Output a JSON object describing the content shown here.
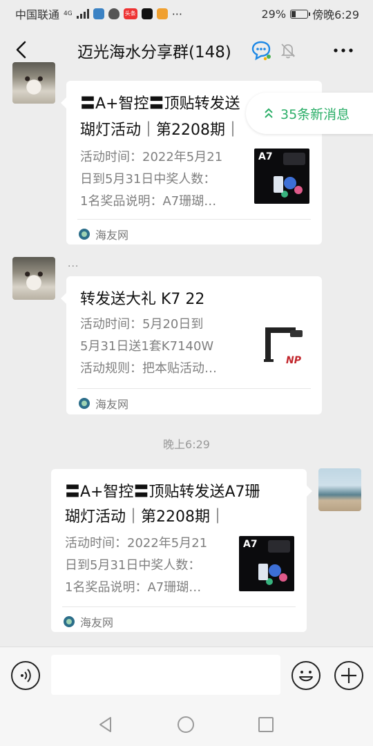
{
  "status_bar": {
    "carrier": "中国联通",
    "network": "4G",
    "app_badge": "头条",
    "more": "···",
    "battery": "29%",
    "battery_level": 0.29,
    "time": "傍晚6:29"
  },
  "header": {
    "title": "迈光海水分享群(148)"
  },
  "new_messages": {
    "label": "35条新消息"
  },
  "messages": [
    {
      "sender": "left",
      "title_lines": [
        "〓A+智控〓顶贴转发送",
        "瑚灯活动｜第2208期｜"
      ],
      "desc_lines": [
        "活动时间：2022年5月21",
        "日到5月31日中奖人数：",
        "1名奖品说明：A7珊瑚…"
      ],
      "thumb_label": "A7",
      "source": "海友网"
    },
    {
      "sender": "left",
      "sender_name": "...",
      "title_lines": [
        "转发送大礼 K7 22"
      ],
      "desc_lines": [
        "活动时间：5月20日到",
        "5月31日送1套K7140W",
        "活动规则：把本贴活动…"
      ],
      "thumb_label": "NP",
      "source": "海友网"
    },
    {
      "sender": "right",
      "title_lines": [
        "〓A+智控〓顶贴转发送A7珊",
        "瑚灯活动｜第2208期｜"
      ],
      "desc_lines": [
        "活动时间：2022年5月21",
        "日到5月31日中奖人数：",
        "1名奖品说明：A7珊瑚…"
      ],
      "thumb_label": "A7",
      "source": "海友网"
    }
  ],
  "timestamp": "晚上6:29",
  "input": {
    "value": "",
    "placeholder": ""
  }
}
